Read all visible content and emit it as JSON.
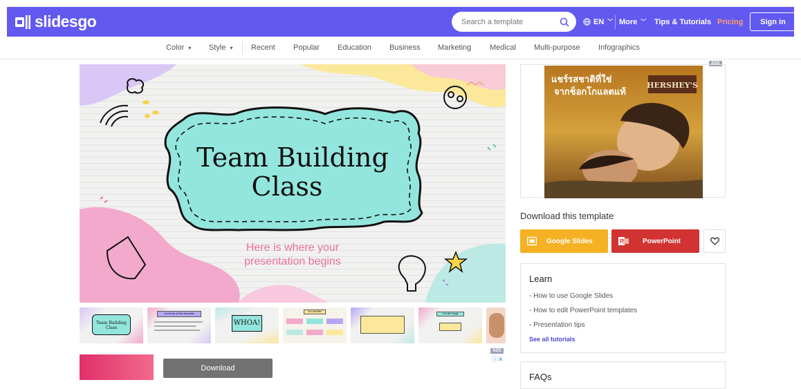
{
  "header": {
    "logo": "slidesgo",
    "search_placeholder": "Search a template",
    "language": "EN",
    "more": "More",
    "tips": "Tips & Tutorials",
    "pricing": "Pricing",
    "signin": "Sign in"
  },
  "categories": [
    {
      "label": "Color",
      "dropdown": "▾"
    },
    {
      "label": "Style",
      "dropdown": "▾"
    },
    {
      "label": "Recent"
    },
    {
      "label": "Popular"
    },
    {
      "label": "Education"
    },
    {
      "label": "Business"
    },
    {
      "label": "Marketing"
    },
    {
      "label": "Medical"
    },
    {
      "label": "Multi-purpose"
    },
    {
      "label": "Infographics"
    }
  ],
  "preview": {
    "title_line1": "Team Building",
    "title_line2": "Class",
    "subtitle_line1": "Here is where your",
    "subtitle_line2": "presentation begins"
  },
  "thumbnails": [
    {
      "title": "Team Building Class"
    },
    {
      "title": "Contents of this template"
    },
    {
      "title": "WHOA!"
    },
    {
      "title": "Our activities"
    },
    {
      "title": ""
    },
    {
      "title": "Left with image"
    },
    {
      "title": ""
    }
  ],
  "ads": {
    "tag": "ADS",
    "right_text_line1": "แชร์รสชาติที่ใช่",
    "right_text_line2": "จากช็อกโกแลตแท้",
    "brand": "HERSHEY'S",
    "bottom_button": "Download"
  },
  "download": {
    "title": "Download this template",
    "google_slides": "Google Slides",
    "powerpoint": "PowerPoint"
  },
  "learn": {
    "title": "Learn",
    "links": [
      "- How to use Google Slides",
      "- How to edit PowerPoint templates",
      "- Presentation tips"
    ],
    "see_all": "See all tutorials"
  },
  "faqs": {
    "title": "FAQs"
  },
  "colors": {
    "brand": "#6259f0",
    "google_slides": "#f5b123",
    "powerpoint": "#d13232",
    "pricing": "#ff9e6d"
  },
  "icons": [
    "search-icon",
    "globe-icon",
    "chevron-down-icon",
    "heart-icon",
    "google-slides-icon",
    "powerpoint-icon",
    "ad-close-icon"
  ]
}
